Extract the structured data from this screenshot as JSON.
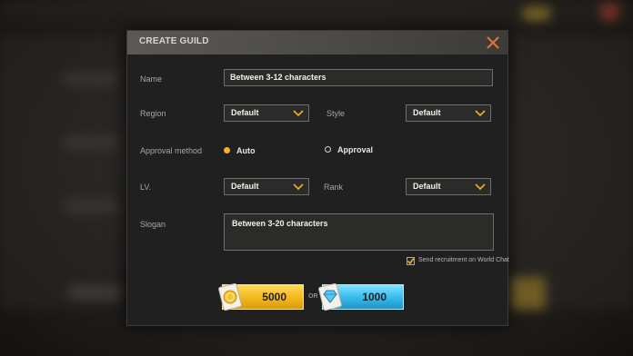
{
  "dialog": {
    "title": "CREATE GUILD",
    "close_icon": "close-icon"
  },
  "form": {
    "name_label": "Name",
    "name_value": "Between 3-12 characters",
    "region_label": "Region",
    "region_value": "Default",
    "style_label": "Style",
    "style_value": "Default",
    "approval_label": "Approval method",
    "approval_options": [
      {
        "label": "Auto",
        "selected": true
      },
      {
        "label": "Approval",
        "selected": false
      }
    ],
    "lv_label": "LV.",
    "lv_value": "Default",
    "rank_label": "Rank",
    "rank_value": "Default",
    "slogan_label": "Slogan",
    "slogan_value": "Between 3-20 characters",
    "recruit_label": "Send recruitment on World Chat",
    "recruit_checked": true
  },
  "purchase": {
    "gold_amount": "5000",
    "or_label": "OR",
    "diamond_amount": "1000"
  },
  "colors": {
    "accent_gold": "#f2b71b",
    "accent_blue": "#37b8ea",
    "close_orange": "#e3723a"
  }
}
